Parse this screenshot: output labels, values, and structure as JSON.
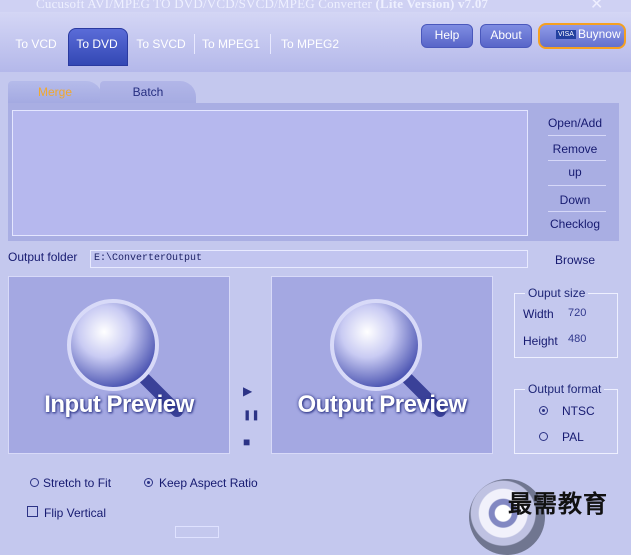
{
  "window": {
    "title": "Cucusoft AVI/MPEG TO DVD/VCD/SVCD/MPEG Converter",
    "edition": "(Lite Version)",
    "version": "v7.07",
    "close_glyph": "✕"
  },
  "nav": {
    "tabs": [
      {
        "label": "To VCD"
      },
      {
        "label": "To DVD"
      },
      {
        "label": "To SVCD"
      },
      {
        "label": "To MPEG1"
      },
      {
        "label": "To MPEG2"
      }
    ],
    "active": "To DVD"
  },
  "top_buttons": {
    "help": "Help",
    "about": "About",
    "buynow": "Buynow",
    "buynow_card_text": "VISA"
  },
  "subtabs": [
    {
      "label": "Merge"
    },
    {
      "label": "Batch"
    }
  ],
  "file_actions": {
    "open_add": "Open/Add",
    "remove": "Remove",
    "up": "up",
    "down": "Down",
    "checklog": "Checklog"
  },
  "output": {
    "label": "Output folder",
    "path": "E:\\ConverterOutput",
    "browse": "Browse"
  },
  "preview": {
    "input": "Input Preview",
    "output": "Output Preview"
  },
  "playback": {
    "play_glyph": "▶",
    "pause_glyph": "❚❚",
    "stop_glyph": "■"
  },
  "output_size": {
    "legend": "Ouput size",
    "width_label": "Width",
    "width_value": "720",
    "height_label": "Height",
    "height_value": "480"
  },
  "output_format": {
    "legend": "Output format",
    "options": [
      {
        "label": "NTSC",
        "selected": true
      },
      {
        "label": "PAL",
        "selected": false
      }
    ]
  },
  "options": {
    "stretch": "Stretch to Fit",
    "keep_aspect": "Keep Aspect Ratio",
    "flip": "Flip Vertical"
  },
  "watermark": "最需教育",
  "colors": {
    "accent": "#3a4bb8",
    "background": "#c4c8ee",
    "merge_tab_text": "#f0a830",
    "buynow_border": "#f5a020"
  }
}
